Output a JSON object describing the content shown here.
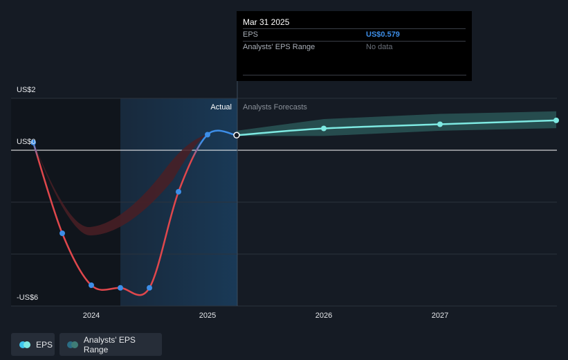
{
  "tooltip": {
    "date": "Mar 31 2025",
    "eps_label": "EPS",
    "eps_value": "US$0.579",
    "range_label": "Analysts' EPS Range",
    "range_value": "No data"
  },
  "sections": {
    "actual": "Actual",
    "forecast": "Analysts Forecasts"
  },
  "legend": {
    "eps": "EPS",
    "range": "Analysts' EPS Range"
  },
  "colors": {
    "background": "#151b24",
    "eps_line_negative": "#e0474c",
    "eps_point": "#3d8ee8",
    "forecast_line": "#7ee9e2",
    "range_band": "#2c5e5c"
  },
  "chart_data": {
    "type": "line",
    "x_ticks": [
      "2024",
      "2025",
      "2026",
      "2027"
    ],
    "y_ticks": [
      "US$2",
      "US$0",
      "-US$6"
    ],
    "ylim": [
      -6,
      2
    ],
    "series": [
      {
        "name": "EPS",
        "kind": "actual",
        "points": [
          {
            "x": 2023.5,
            "y": 0.3
          },
          {
            "x": 2023.75,
            "y": -3.2
          },
          {
            "x": 2024.0,
            "y": -5.2
          },
          {
            "x": 2024.25,
            "y": -5.3
          },
          {
            "x": 2024.5,
            "y": -5.3
          },
          {
            "x": 2024.75,
            "y": -1.6
          },
          {
            "x": 2025.0,
            "y": 0.6
          },
          {
            "x": 2025.25,
            "y": 0.579
          }
        ]
      },
      {
        "name": "EPS",
        "kind": "forecast",
        "points": [
          {
            "x": 2025.25,
            "y": 0.579
          },
          {
            "x": 2026.0,
            "y": 0.84
          },
          {
            "x": 2027.0,
            "y": 1.0
          },
          {
            "x": 2028.0,
            "y": 1.15
          }
        ]
      }
    ],
    "range_band": [
      {
        "x": 2025.25,
        "low": 0.55,
        "high": 0.75
      },
      {
        "x": 2026.0,
        "low": 0.55,
        "high": 1.2
      },
      {
        "x": 2027.0,
        "low": 0.75,
        "high": 1.4
      },
      {
        "x": 2028.0,
        "low": 0.85,
        "high": 1.5
      }
    ],
    "grid": true,
    "legend_position": "bottom-left"
  }
}
